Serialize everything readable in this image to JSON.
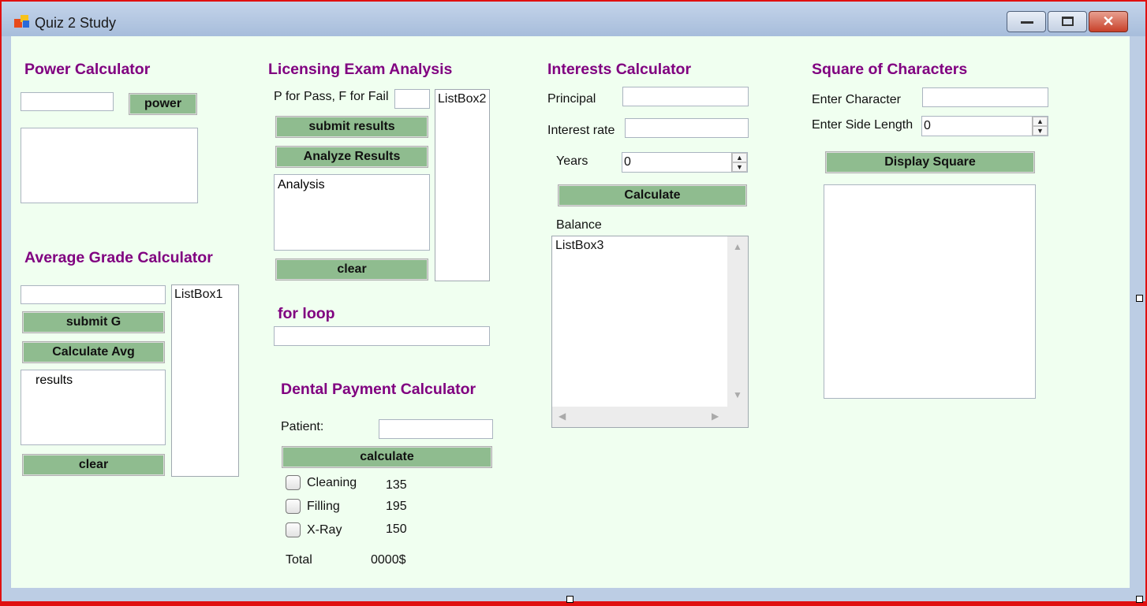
{
  "window": {
    "title": "Quiz 2 Study",
    "minimize_glyph": "—",
    "maximize_glyph": "☐",
    "close_glyph": "✕"
  },
  "power": {
    "heading": "Power Calculator",
    "input_value": "",
    "button_label": "power",
    "output": ""
  },
  "average": {
    "heading": "Average Grade Calculator",
    "input_value": "",
    "submit_label": "submit G",
    "calc_label": "Calculate Avg",
    "results_text": "results",
    "clear_label": "clear",
    "listbox": "ListBox1"
  },
  "licensing": {
    "heading": "Licensing Exam Analysis",
    "prompt": "P for Pass, F for Fail",
    "input_value": "",
    "submit_label": "submit results",
    "analyze_label": "Analyze Results",
    "analysis_text": "Analysis",
    "clear_label": "clear",
    "listbox": "ListBox2"
  },
  "forloop": {
    "heading": "for loop",
    "input_value": ""
  },
  "dental": {
    "heading": "Dental Payment Calculator",
    "patient_label": "Patient:",
    "patient_value": "",
    "calc_label": "calculate",
    "services": [
      {
        "name": "Cleaning",
        "price": "135",
        "checked": false
      },
      {
        "name": "Filling",
        "price": "195",
        "checked": false
      },
      {
        "name": "X-Ray",
        "price": "150",
        "checked": false
      }
    ],
    "total_label": "Total",
    "total_value": "0000$"
  },
  "interest": {
    "heading": "Interests Calculator",
    "principal_label": "Principal",
    "principal_value": "",
    "rate_label": "Interest rate",
    "rate_value": "",
    "years_label": "Years",
    "years_value": "0",
    "calc_label": "Calculate",
    "balance_label": "Balance",
    "listbox": "ListBox3"
  },
  "square": {
    "heading": "Square of Characters",
    "char_label": "Enter Character",
    "char_value": "",
    "side_label": "Enter Side Length",
    "side_value": "0",
    "display_label": "Display Square",
    "output": ""
  },
  "colors": {
    "heading": "#800080",
    "button": "#8fbc8f",
    "background": "#f0fff0",
    "border": "#e01010"
  }
}
